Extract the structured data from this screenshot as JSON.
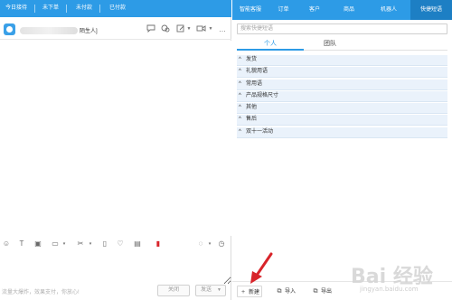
{
  "left": {
    "status_tabs": [
      "今日接待",
      "未下单",
      "未付款",
      "已付款"
    ],
    "contact_name": "陌生人]",
    "hint": "流量大爆炸，效果支付，你放心!",
    "close_label": "关闭",
    "send_label": "发送",
    "header_icons": [
      "chat-bubble-icon",
      "switch-icon",
      "edit-icon",
      "video-icon",
      "more-icon"
    ],
    "toolbar_icons": [
      "emoji-icon",
      "text-icon",
      "image-icon",
      "calendar-icon",
      "folder-icon",
      "scissors-icon",
      "phone-icon",
      "heart-icon",
      "card-icon",
      "red-packet-icon",
      "chat-icon",
      "history-icon"
    ]
  },
  "right": {
    "tabs": [
      "智能客服",
      "订单",
      "客户",
      "商品",
      "机器人",
      "快捷短语"
    ],
    "active_tab": "快捷短语",
    "search_placeholder": "搜索快捷短语",
    "sub_tabs": [
      "个人",
      "团队"
    ],
    "active_sub_tab": "个人",
    "categories": [
      "发货",
      "礼貌用语",
      "常用语",
      "产品规格尺寸",
      "其他",
      "售后",
      "双十一活动"
    ],
    "actions": {
      "new_label": "新建",
      "import_label": "导入",
      "export_label": "导出"
    }
  },
  "watermark": {
    "text": "Bai 经验",
    "sub": "jingyan.baidu.com"
  },
  "colors": {
    "accent": "#2d9be6",
    "active_tab_bg": "#1d7fc4",
    "category_bg": "#eaf2fb",
    "annotation_red": "#d8242a"
  }
}
